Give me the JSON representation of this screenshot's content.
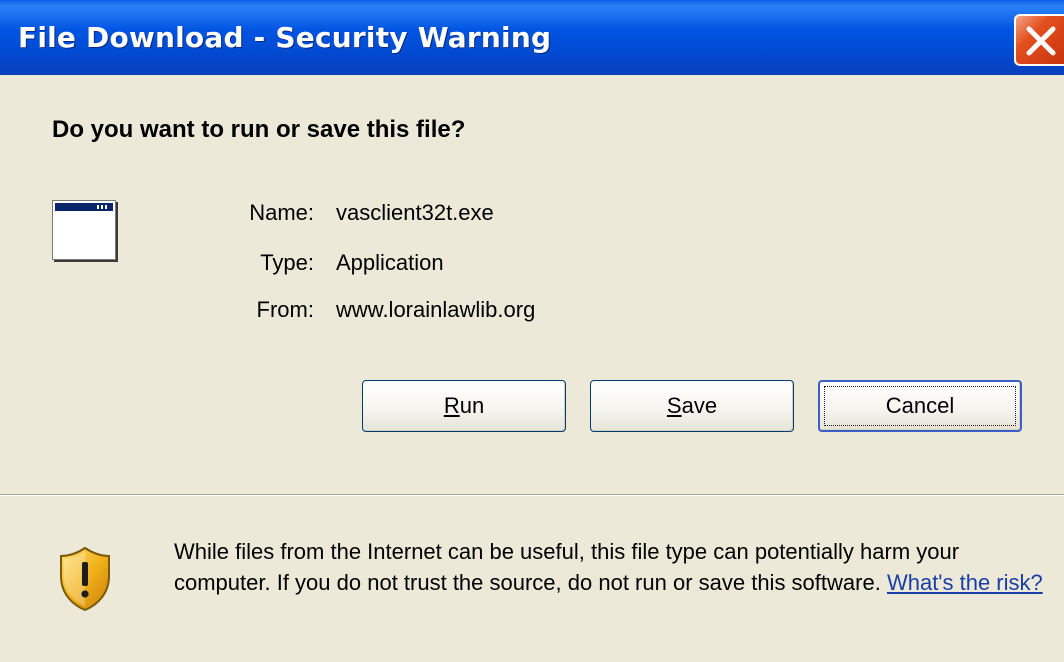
{
  "window": {
    "title": "File Download - Security Warning"
  },
  "prompt": {
    "question": "Do you want to run or save this file?"
  },
  "file": {
    "name_label": "Name:",
    "name_value": "vasclient32t.exe",
    "type_label": "Type:",
    "type_value": "Application",
    "from_label": "From:",
    "from_value": "www.lorainlawlib.org"
  },
  "buttons": {
    "run": {
      "accel": "R",
      "rest": "un"
    },
    "save": {
      "accel": "S",
      "rest": "ave"
    },
    "cancel": "Cancel"
  },
  "warning": {
    "text": "While files from the Internet can be useful, this file type can potentially harm your computer. If you do not trust the source, do not run or save this software.",
    "link": "What's the risk?"
  },
  "icons": {
    "close": "close-icon",
    "application": "application-window-icon",
    "security": "security-shield-icon"
  },
  "colors": {
    "titlebar": "#0054e3",
    "close_button": "#e3501f",
    "dialog_background": "#ece9d8",
    "link": "#1a3ea8",
    "shield": "#f2b21c"
  }
}
